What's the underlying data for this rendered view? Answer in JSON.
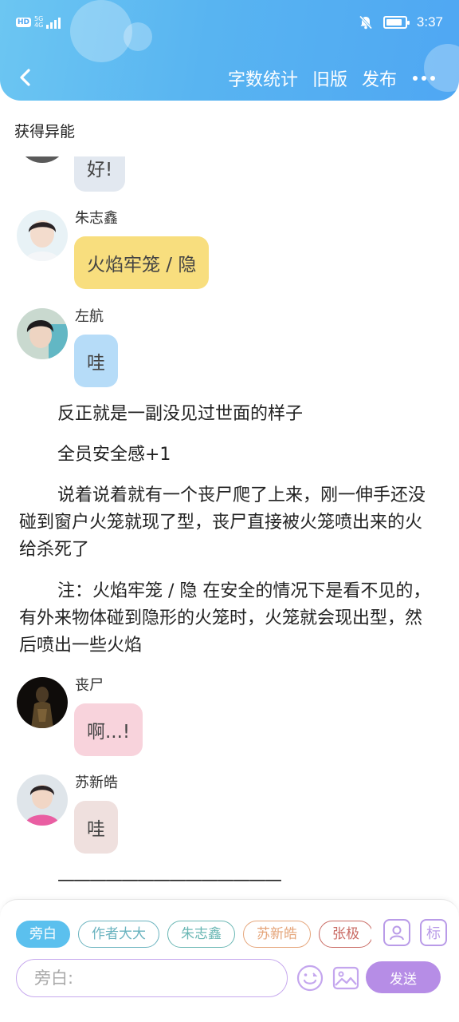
{
  "status_bar": {
    "network_badge": "HD",
    "network_gen": "5G",
    "network_sub": "4G",
    "time": "3:37",
    "battery_level": 0.85
  },
  "nav": {
    "actions": [
      "字数统计",
      "旧版",
      "发布"
    ]
  },
  "chapter_title": "获得异能",
  "messages": [
    {
      "type": "bubble",
      "text": "好!",
      "bg": "#e2e8f0"
    },
    {
      "type": "bubble",
      "speaker": "朱志鑫",
      "text": "火焰牢笼 / 隐",
      "bg": "#f8de7e"
    },
    {
      "type": "bubble",
      "speaker": "左航",
      "text": "哇",
      "bg": "#b6dcf8"
    },
    {
      "type": "narration",
      "text": "反正就是一副没见过世面的样子"
    },
    {
      "type": "narration",
      "text": "全员安全感+1"
    },
    {
      "type": "narration",
      "text": "说着说着就有一个丧尸爬了上来，刚一伸手还没碰到窗户火笼就现了型，丧尸直接被火笼喷出来的火给杀死了"
    },
    {
      "type": "narration",
      "text": "注：火焰牢笼 / 隐 在安全的情况下是看不见的，有外来物体碰到隐形的火笼时，火笼就会现出型，然后喷出一些火焰"
    },
    {
      "type": "bubble",
      "speaker": "丧尸",
      "text": "啊...!",
      "bg": "#f8d3dc"
    },
    {
      "type": "bubble",
      "speaker": "苏新皓",
      "text": "哇",
      "bg": "#efe0de"
    },
    {
      "type": "narration",
      "text": "——————————————"
    }
  ],
  "composer": {
    "chips": [
      {
        "label": "旁白",
        "color": "#5bc0ee",
        "filled": true
      },
      {
        "label": "作者大大",
        "color": "#6ab3bf",
        "filled": false
      },
      {
        "label": "朱志鑫",
        "color": "#6ab7b4",
        "filled": false
      },
      {
        "label": "苏新皓",
        "color": "#e5a57a",
        "filled": false
      },
      {
        "label": "张极",
        "color": "#c96a63",
        "filled": false
      }
    ],
    "mark_icon_text": "标",
    "input_placeholder": "旁白:",
    "send_label": "发送"
  },
  "colors": {
    "header_start": "#6cc6f2",
    "header_end": "#4fa7f3",
    "accent_purple": "#b68de6"
  }
}
